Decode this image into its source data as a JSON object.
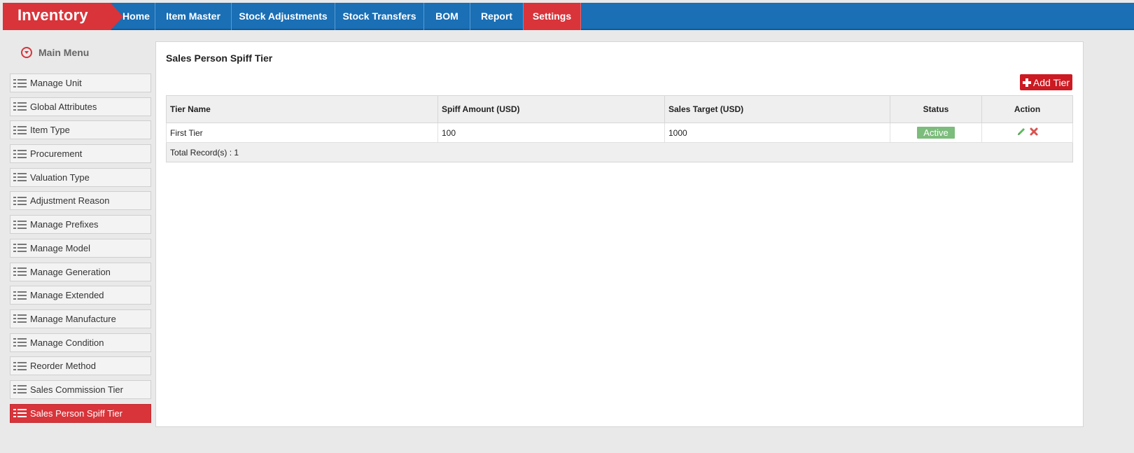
{
  "app": {
    "brand": "Inventory"
  },
  "nav": {
    "items": [
      {
        "label": "Home"
      },
      {
        "label": "Item Master"
      },
      {
        "label": "Stock Adjustments"
      },
      {
        "label": "Stock Transfers"
      },
      {
        "label": "BOM"
      },
      {
        "label": "Report"
      },
      {
        "label": "Settings",
        "active": true
      }
    ]
  },
  "sidebar": {
    "header": "Main Menu",
    "items": [
      {
        "label": "Manage Unit"
      },
      {
        "label": "Global Attributes"
      },
      {
        "label": "Item Type"
      },
      {
        "label": "Procurement"
      },
      {
        "label": "Valuation Type"
      },
      {
        "label": "Adjustment Reason"
      },
      {
        "label": "Manage Prefixes"
      },
      {
        "label": "Manage Model"
      },
      {
        "label": "Manage Generation"
      },
      {
        "label": "Manage Extended"
      },
      {
        "label": "Manage Manufacture"
      },
      {
        "label": "Manage Condition"
      },
      {
        "label": "Reorder Method"
      },
      {
        "label": "Sales Commission Tier"
      },
      {
        "label": "Sales Person Spiff Tier",
        "active": true
      }
    ]
  },
  "main": {
    "title": "Sales Person Spiff Tier",
    "add_button": "Add Tier",
    "table": {
      "headers": {
        "tier_name": "Tier Name",
        "spiff_amount": "Spiff Amount (USD)",
        "sales_target": "Sales Target (USD)",
        "status": "Status",
        "action": "Action"
      },
      "rows": [
        {
          "tier_name": "First Tier",
          "spiff_amount": "100",
          "sales_target": "1000",
          "status": "Active"
        }
      ],
      "footer": "Total Record(s) :  1"
    }
  },
  "colors": {
    "brand_red": "#d8343a",
    "nav_blue": "#1a6fb5",
    "status_green": "#7cbc7c",
    "add_red": "#cc1a22"
  }
}
